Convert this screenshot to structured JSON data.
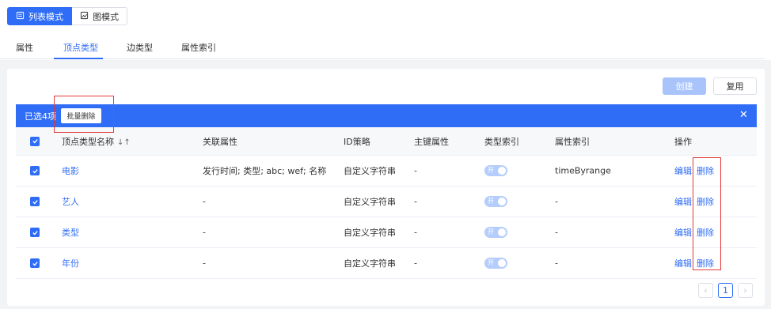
{
  "mode_switch": {
    "list_mode": "列表模式",
    "graph_mode": "图模式"
  },
  "tabs": [
    {
      "label": "属性"
    },
    {
      "label": "顶点类型"
    },
    {
      "label": "边类型"
    },
    {
      "label": "属性索引"
    }
  ],
  "toolbar": {
    "create_label": "创建",
    "reuse_label": "复用"
  },
  "selection_bar": {
    "selected_text": "已选4项",
    "batch_delete_label": "批量删除",
    "close_glyph": "✕"
  },
  "table": {
    "headers": {
      "name": "顶点类型名称",
      "sort_glyph": "↓↑",
      "related_props": "关联属性",
      "id_strategy": "ID策略",
      "primary_key": "主键属性",
      "type_index": "类型索引",
      "prop_index": "属性索引",
      "actions": "操作"
    },
    "rows": [
      {
        "name": "电影",
        "related_props": "发行时间; 类型; abc; wef; 名称",
        "id_strategy": "自定义字符串",
        "primary_key": "-",
        "toggle_label": "开",
        "prop_index": "timeByrange",
        "edit": "编辑",
        "delete": "删除"
      },
      {
        "name": "艺人",
        "related_props": "-",
        "id_strategy": "自定义字符串",
        "primary_key": "-",
        "toggle_label": "开",
        "prop_index": "-",
        "edit": "编辑",
        "delete": "删除"
      },
      {
        "name": "类型",
        "related_props": "-",
        "id_strategy": "自定义字符串",
        "primary_key": "-",
        "toggle_label": "开",
        "prop_index": "-",
        "edit": "编辑",
        "delete": "删除"
      },
      {
        "name": "年份",
        "related_props": "-",
        "id_strategy": "自定义字符串",
        "primary_key": "-",
        "toggle_label": "开",
        "prop_index": "-",
        "edit": "编辑",
        "delete": "删除"
      }
    ]
  },
  "pagination": {
    "prev_glyph": "‹",
    "current_page": "1",
    "next_glyph": "›"
  },
  "colors": {
    "accent": "#2f6df6",
    "highlight": "#e23b3b"
  }
}
